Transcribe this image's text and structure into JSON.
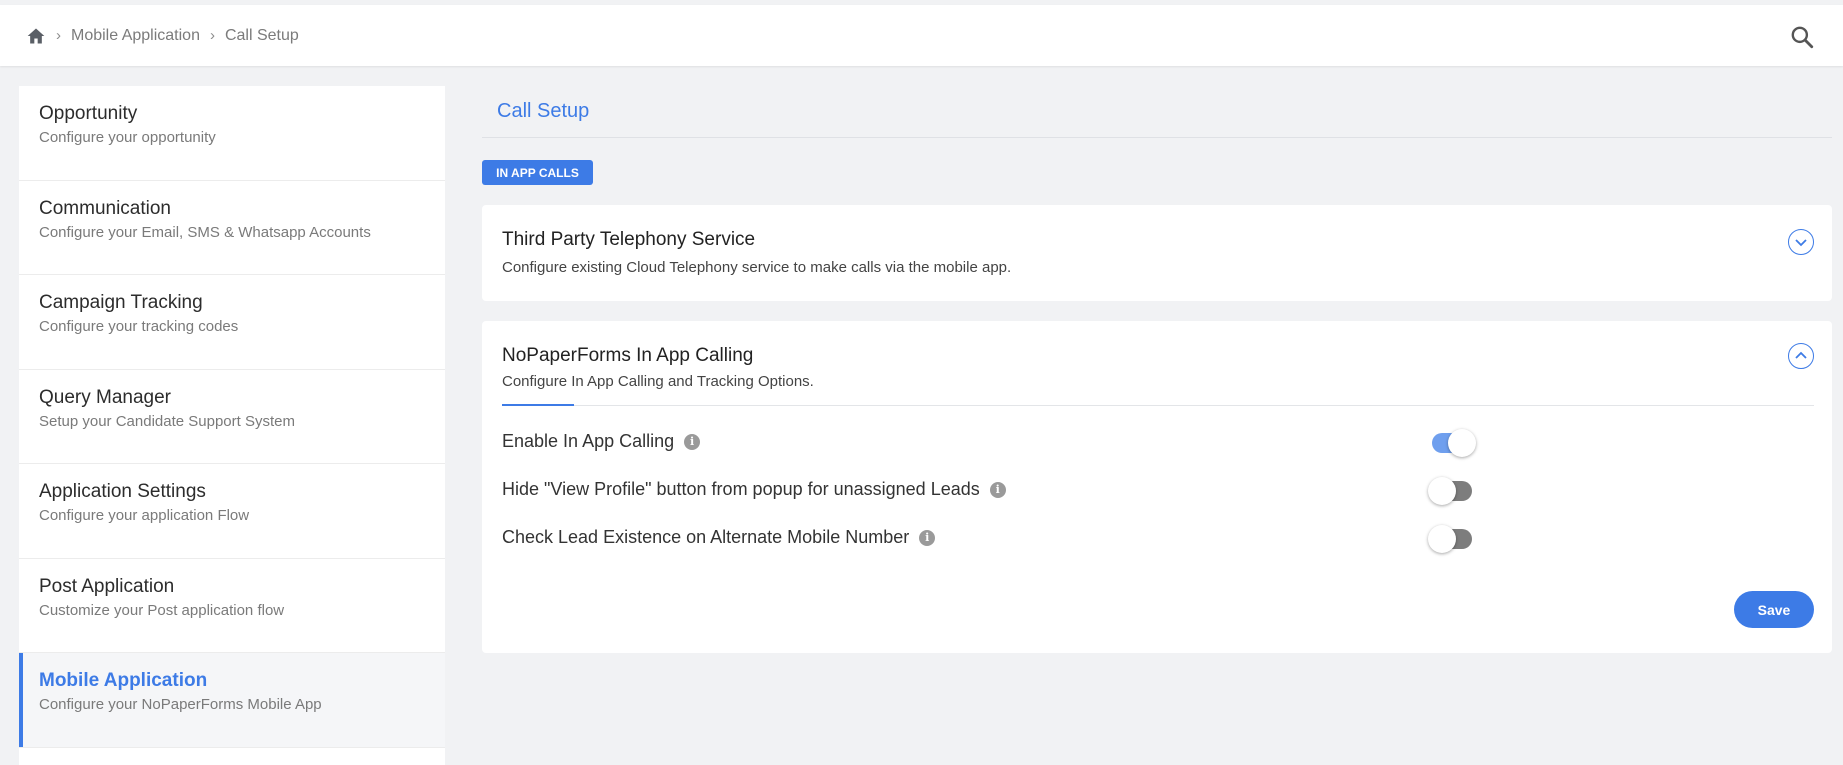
{
  "breadcrumb": {
    "home_icon": "home-icon",
    "items": [
      "Mobile Application",
      "Call Setup"
    ]
  },
  "header": {
    "search_icon": "search-icon"
  },
  "sidebar": {
    "items": [
      {
        "title": "Opportunity",
        "subtitle": "Configure your opportunity"
      },
      {
        "title": "Communication",
        "subtitle": "Configure your Email, SMS & Whatsapp Accounts"
      },
      {
        "title": "Campaign Tracking",
        "subtitle": "Configure your tracking codes"
      },
      {
        "title": "Query Manager",
        "subtitle": "Setup your Candidate Support System"
      },
      {
        "title": "Application Settings",
        "subtitle": "Configure your application Flow"
      },
      {
        "title": "Post Application",
        "subtitle": "Customize your Post application flow"
      },
      {
        "title": "Mobile Application",
        "subtitle": "Configure your NoPaperForms Mobile App",
        "active": true
      }
    ]
  },
  "main": {
    "title": "Call Setup",
    "tag": "IN APP CALLS",
    "sections": [
      {
        "title": "Third Party Telephony Service",
        "description": "Configure existing Cloud Telephony service to make calls via the mobile app.",
        "expanded": false
      },
      {
        "title": "NoPaperForms In App Calling",
        "description": "Configure In App Calling and Tracking Options.",
        "expanded": true,
        "options": [
          {
            "label": "Enable In App Calling",
            "enabled": true
          },
          {
            "label": "Hide \"View Profile\" button from popup for unassigned Leads",
            "enabled": false
          },
          {
            "label": "Check Lead Existence on Alternate Mobile Number",
            "enabled": false
          }
        ],
        "save_label": "Save"
      }
    ]
  },
  "colors": {
    "accent": "#3d7be6",
    "background": "#f1f2f4",
    "toggle_off": "#7d7d7d",
    "toggle_on": "#6f9fee"
  }
}
